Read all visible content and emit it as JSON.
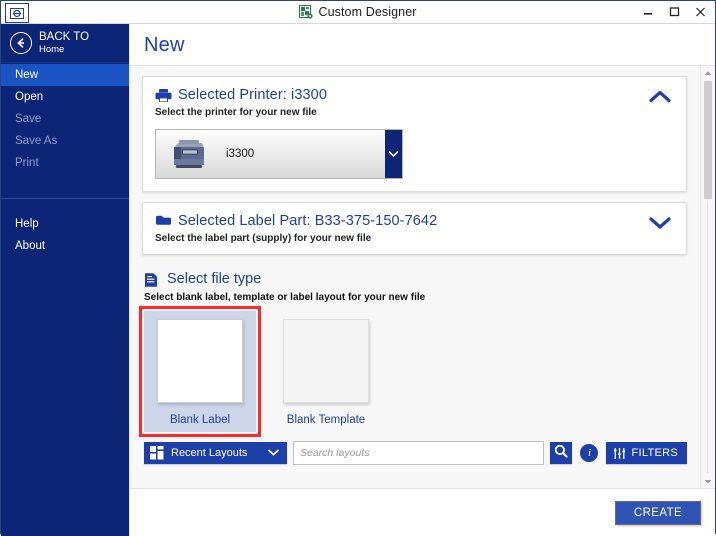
{
  "window": {
    "title": "Custom Designer",
    "system_icon": "app-system-icon",
    "minimize_label": "Minimize",
    "maximize_label": "Maximize",
    "close_label": "Close"
  },
  "sidebar": {
    "back": {
      "line1": "BACK TO",
      "line2": "Home",
      "icon": "back-arrow-icon"
    },
    "items": [
      {
        "label": "New",
        "state": "active"
      },
      {
        "label": "Open",
        "state": "enabled"
      },
      {
        "label": "Save",
        "state": "disabled"
      },
      {
        "label": "Save As",
        "state": "disabled"
      },
      {
        "label": "Print",
        "state": "disabled"
      }
    ],
    "items2": [
      {
        "label": "Help",
        "state": "enabled"
      },
      {
        "label": "About",
        "state": "enabled"
      }
    ]
  },
  "page": {
    "title": "New"
  },
  "printer_card": {
    "icon": "printer-icon",
    "title": "Selected Printer:  i3300",
    "subtitle": "Select the printer for your new file",
    "collapse_state": "expanded",
    "selected_printer": "i3300"
  },
  "label_part_card": {
    "icon": "label-part-icon",
    "title": "Selected Label Part:  B33-375-150-7642",
    "subtitle": "Select the label part (supply) for your new file",
    "collapse_state": "collapsed",
    "selected_part": "B33-375-150-7642"
  },
  "file_type": {
    "icon": "document-icon",
    "title": "Select file type",
    "subtitle": "Select blank label, template or label layout for your new file",
    "tiles": [
      {
        "label": "Blank Label",
        "selected": true
      },
      {
        "label": "Blank Template",
        "selected": false
      }
    ]
  },
  "toolbar": {
    "recent_layouts_label": "Recent Layouts",
    "recent_layouts_icon": "grid-icon",
    "recent_layouts_chevron": "chevron-down-icon",
    "search_placeholder": "Search layouts",
    "search_value": "",
    "search_icon": "search-icon",
    "info_icon": "info-icon",
    "info_glyph": "i",
    "filters_label": "FILTERS",
    "filters_icon": "sliders-icon"
  },
  "footer": {
    "create_label": "CREATE"
  },
  "colors": {
    "sidebar_bg": "#0c2577",
    "sidebar_active": "#1a53c4",
    "accent_blue": "#1d3faa",
    "selection_outline": "#fb2b2b",
    "tile_selected_bg": "#cdd6e8",
    "content_bg": "#f7f7f7",
    "create_button": "#3054b5"
  }
}
